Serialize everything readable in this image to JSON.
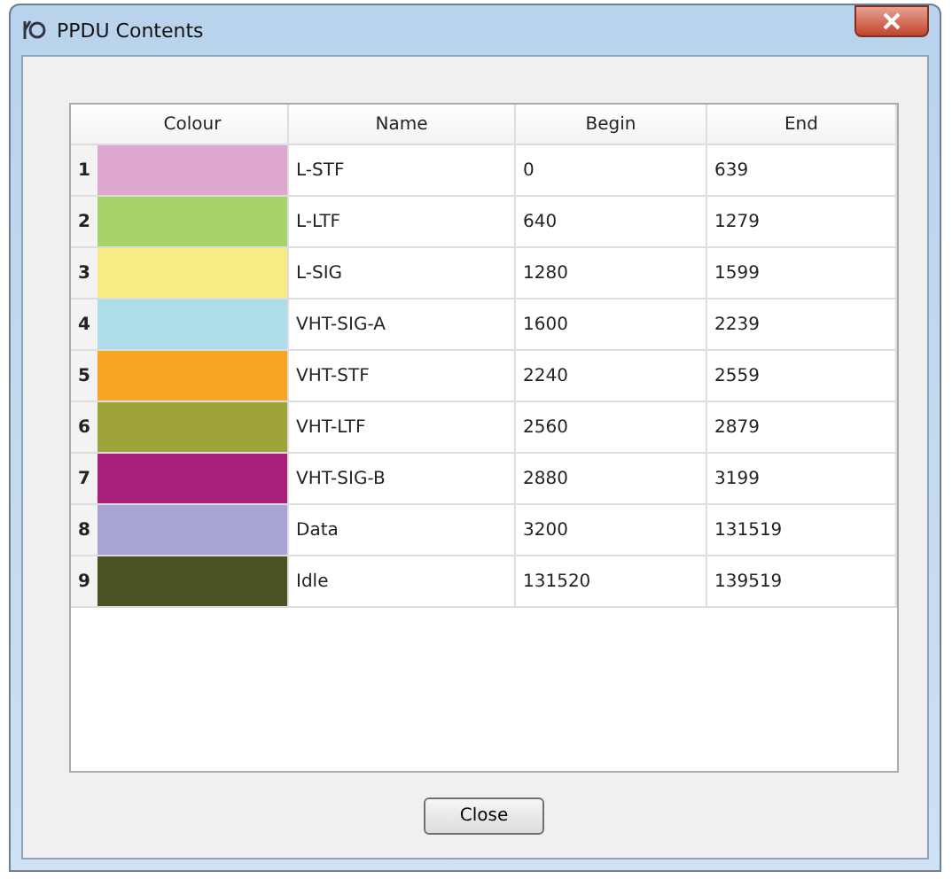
{
  "window": {
    "title": "PPDU Contents"
  },
  "table": {
    "columns": [
      "Colour",
      "Name",
      "Begin",
      "End"
    ],
    "rows": [
      {
        "index": "1",
        "color": "#dda7cf",
        "name": "L-STF",
        "begin": "0",
        "end": "639"
      },
      {
        "index": "2",
        "color": "#a6d46a",
        "name": "L-LTF",
        "begin": "640",
        "end": "1279"
      },
      {
        "index": "3",
        "color": "#f8ec84",
        "name": "L-SIG",
        "begin": "1280",
        "end": "1599"
      },
      {
        "index": "4",
        "color": "#addde9",
        "name": "VHT-SIG-A",
        "begin": "1600",
        "end": "2239"
      },
      {
        "index": "5",
        "color": "#f6a623",
        "name": "VHT-STF",
        "begin": "2240",
        "end": "2559"
      },
      {
        "index": "6",
        "color": "#9ea43a",
        "name": "VHT-LTF",
        "begin": "2560",
        "end": "2879"
      },
      {
        "index": "7",
        "color": "#a8207a",
        "name": "VHT-SIG-B",
        "begin": "2880",
        "end": "3199"
      },
      {
        "index": "8",
        "color": "#a7a3d3",
        "name": "Data",
        "begin": "3200",
        "end": "131519"
      },
      {
        "index": "9",
        "color": "#4c5224",
        "name": "Idle",
        "begin": "131520",
        "end": "139519"
      }
    ]
  },
  "buttons": [
    "Close"
  ]
}
